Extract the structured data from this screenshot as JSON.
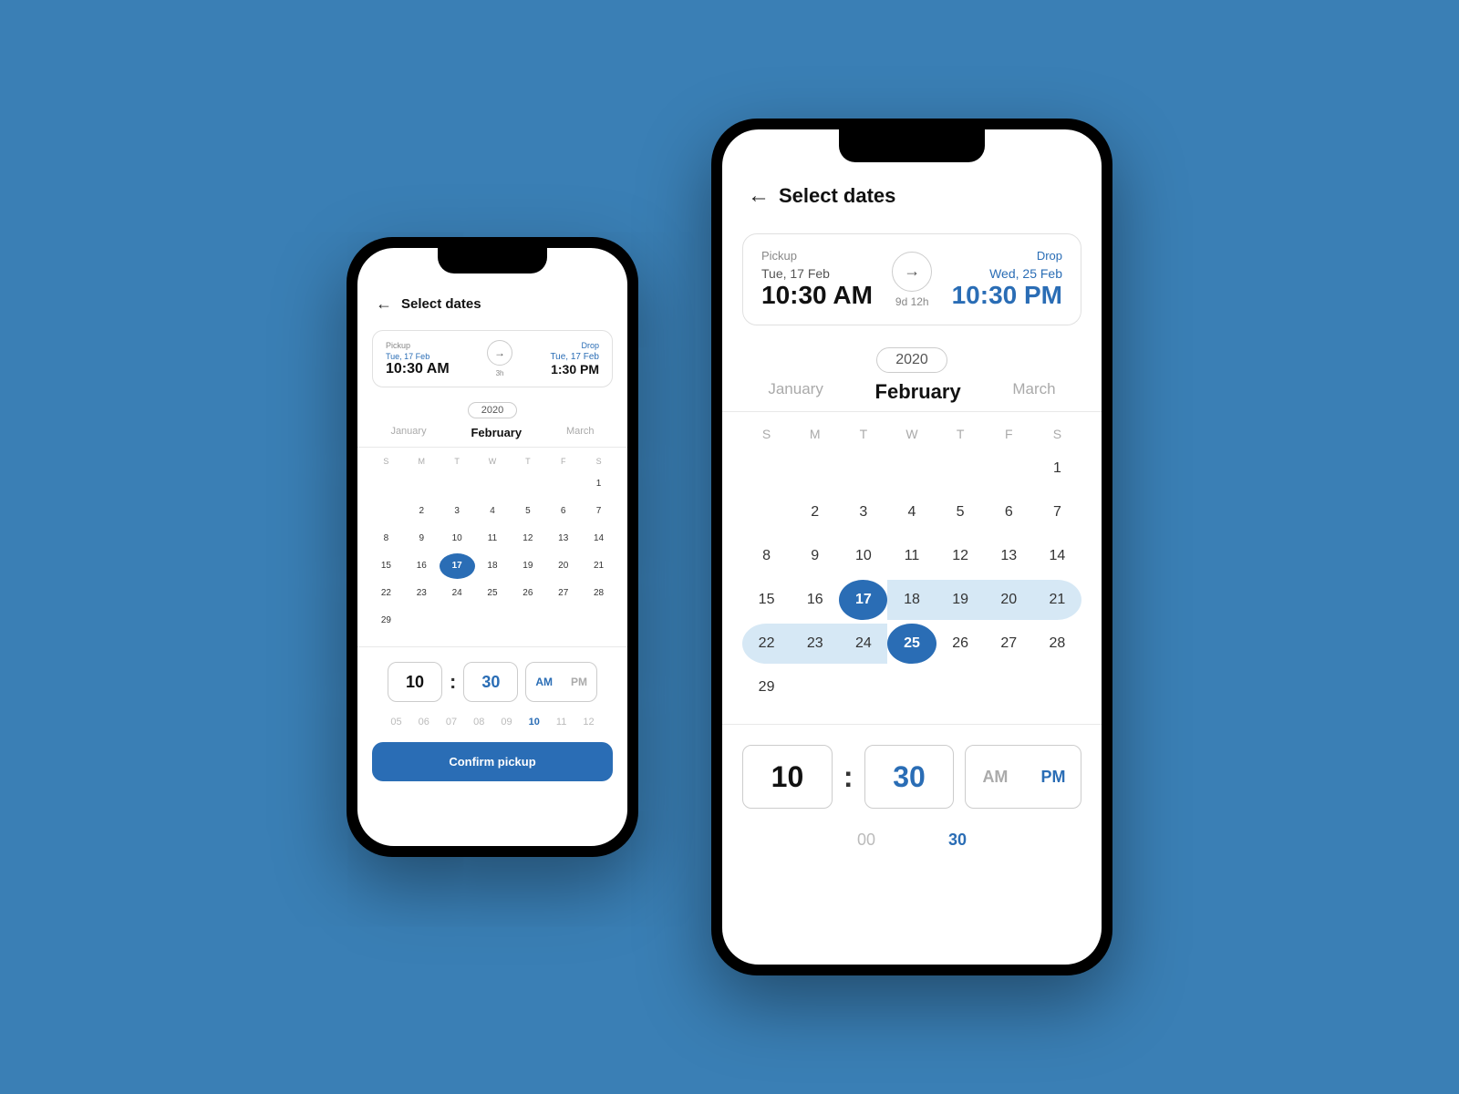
{
  "app": {
    "background": "#3a7fb5"
  },
  "phone_small": {
    "header": {
      "back_label": "←",
      "title": "Select dates"
    },
    "pickup": {
      "label": "Pickup",
      "day": "Tue, 17 Feb",
      "time": "10:30 AM"
    },
    "drop": {
      "label": "Drop",
      "day": "Tue, 17 Feb",
      "time": "1:30 PM"
    },
    "duration": "3h",
    "year": "2020",
    "months": [
      "January",
      "February",
      "March"
    ],
    "active_month": "February",
    "day_headers": [
      "S",
      "M",
      "T",
      "W",
      "T",
      "F",
      "S"
    ],
    "calendar": [
      [
        "",
        "",
        "",
        "",
        "",
        "",
        "1"
      ],
      [
        "",
        "2",
        "3",
        "4",
        "5",
        "6",
        "7"
      ],
      [
        "8",
        "9",
        "10",
        "11",
        "12",
        "13",
        "14"
      ],
      [
        "15",
        "16",
        "17",
        "18",
        "19",
        "20",
        "21"
      ],
      [
        "22",
        "23",
        "24",
        "25",
        "26",
        "27",
        "28"
      ],
      [
        "29",
        "",
        "",
        "",
        "",
        "",
        ""
      ]
    ],
    "selected_start": "17",
    "time_hour": "10",
    "time_minutes": "30",
    "ampm": [
      "AM",
      "PM"
    ],
    "active_ampm": "AM",
    "scroll_nums": [
      "05",
      "06",
      "07",
      "08",
      "09",
      "10",
      "11",
      "12"
    ],
    "active_scroll": "10",
    "confirm_label": "Confirm pickup"
  },
  "phone_large": {
    "header": {
      "back_label": "←",
      "title": "Select dates"
    },
    "pickup": {
      "label": "Pickup",
      "day": "Tue, 17 Feb",
      "time": "10:30 AM"
    },
    "drop": {
      "label": "Drop",
      "day": "Wed, 25 Feb",
      "time": "10:30 PM"
    },
    "duration": "9d 12h",
    "year": "2020",
    "months": [
      "January",
      "February",
      "March"
    ],
    "active_month": "February",
    "day_headers": [
      "S",
      "M",
      "T",
      "W",
      "T",
      "F",
      "S"
    ],
    "calendar": [
      [
        "",
        "",
        "",
        "",
        "",
        "",
        "1"
      ],
      [
        "",
        "2",
        "3",
        "4",
        "5",
        "6",
        "7"
      ],
      [
        "8",
        "9",
        "10",
        "11",
        "12",
        "13",
        "14"
      ],
      [
        "15",
        "16",
        "17",
        "18",
        "19",
        "20",
        "21"
      ],
      [
        "22",
        "23",
        "24",
        "25",
        "26",
        "27",
        "28"
      ],
      [
        "29",
        "",
        "",
        "",
        "",
        "",
        ""
      ]
    ],
    "selected_start": "17",
    "selected_end": "25",
    "range": [
      "18",
      "19",
      "20",
      "21",
      "22",
      "23",
      "24"
    ],
    "time_hour": "10",
    "time_minutes": "30",
    "ampm": [
      "AM",
      "PM"
    ],
    "active_ampm": "PM",
    "scroll_nums_h": [
      "00",
      "30"
    ],
    "active_scroll_h": "30"
  }
}
